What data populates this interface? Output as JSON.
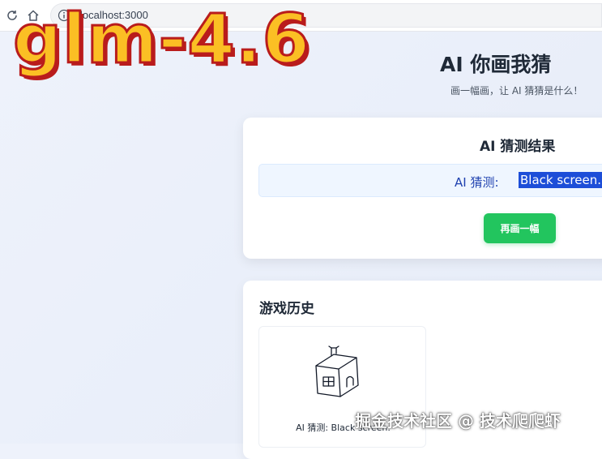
{
  "browser": {
    "url": "localhost:3000"
  },
  "overlay": {
    "model_label": "glm-4.6",
    "footer_watermark": "掘金技术社区 @ 技术爬爬虾"
  },
  "header": {
    "title": "AI 你画我猜",
    "subtitle": "画一幅画，让 AI 猜猜是什么！"
  },
  "result": {
    "title": "AI 猜测结果",
    "guess_prefix": "AI 猜测:",
    "guess_value": "Black screen.",
    "again_button": "再画一幅"
  },
  "history": {
    "title": "游戏历史",
    "items": [
      {
        "caption": "AI 猜测: Black screen.",
        "drawing": "house-sketch"
      }
    ]
  },
  "colors": {
    "accent_green": "#22c55e",
    "selection_blue": "#1d4ed8",
    "watermark_fill": "#fbbf24",
    "watermark_stroke": "#b91c1c"
  }
}
